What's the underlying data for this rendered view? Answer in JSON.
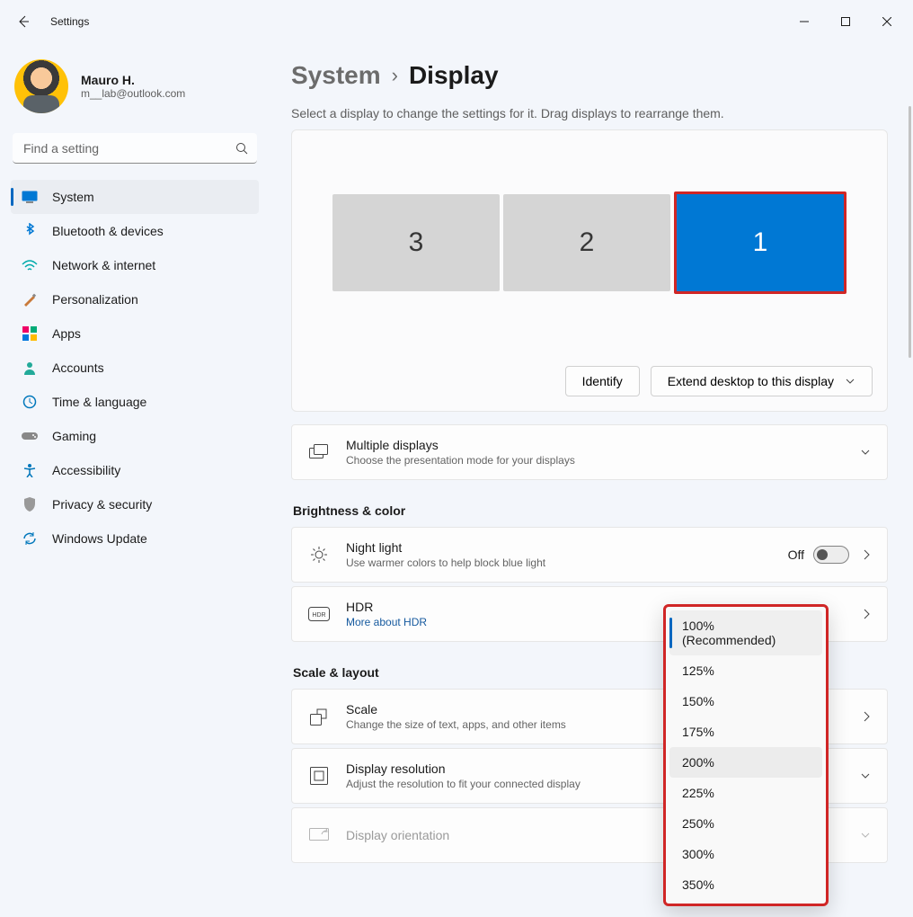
{
  "titlebar": {
    "title": "Settings"
  },
  "profile": {
    "name": "Mauro H.",
    "email": "m__lab@outlook.com"
  },
  "search": {
    "placeholder": "Find a setting"
  },
  "nav": [
    {
      "label": "System",
      "icon": "system"
    },
    {
      "label": "Bluetooth & devices",
      "icon": "bluetooth"
    },
    {
      "label": "Network & internet",
      "icon": "network"
    },
    {
      "label": "Personalization",
      "icon": "personalization"
    },
    {
      "label": "Apps",
      "icon": "apps"
    },
    {
      "label": "Accounts",
      "icon": "accounts"
    },
    {
      "label": "Time & language",
      "icon": "time"
    },
    {
      "label": "Gaming",
      "icon": "gaming"
    },
    {
      "label": "Accessibility",
      "icon": "accessibility"
    },
    {
      "label": "Privacy & security",
      "icon": "privacy"
    },
    {
      "label": "Windows Update",
      "icon": "update"
    }
  ],
  "breadcrumb": {
    "parent": "System",
    "current": "Display"
  },
  "subtitle": "Select a display to change the settings for it. Drag displays to rearrange them.",
  "monitors": {
    "m3": "3",
    "m2": "2",
    "m1": "1"
  },
  "arranger": {
    "identify": "Identify",
    "extend": "Extend desktop to this display"
  },
  "multiple_displays": {
    "title": "Multiple displays",
    "sub": "Choose the presentation mode for your displays"
  },
  "section_brightness": "Brightness & color",
  "night_light": {
    "title": "Night light",
    "sub": "Use warmer colors to help block blue light",
    "state": "Off"
  },
  "hdr": {
    "title": "HDR",
    "link": "More about HDR"
  },
  "section_scale": "Scale & layout",
  "scale": {
    "title": "Scale",
    "sub": "Change the size of text, apps, and other items"
  },
  "resolution": {
    "title": "Display resolution",
    "sub": "Adjust the resolution to fit your connected display"
  },
  "orientation": {
    "title": "Display orientation"
  },
  "scale_options": [
    "100% (Recommended)",
    "125%",
    "150%",
    "175%",
    "200%",
    "225%",
    "250%",
    "300%",
    "350%"
  ]
}
